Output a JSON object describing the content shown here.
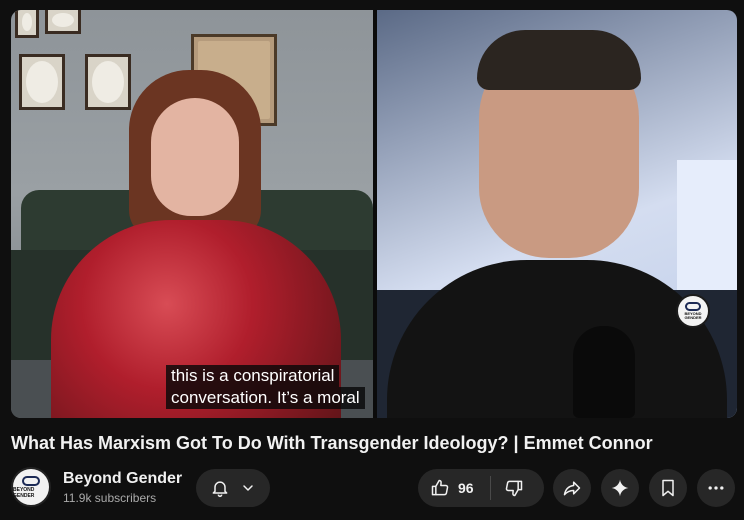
{
  "video": {
    "captions": [
      "this is a conspiratorial",
      "conversation. It’s a moral"
    ],
    "watermark_text": "BEYOND GENDER"
  },
  "title": "What Has Marxism Got To Do With Transgender Ideology? | Emmet Connor",
  "channel": {
    "name": "Beyond Gender",
    "subscribers": "11.9k subscribers",
    "avatar_text": "BEYOND GENDER"
  },
  "actions": {
    "like_count": "96"
  },
  "icons": {
    "notification": "bell-icon",
    "dropdown": "chevron-down-icon",
    "like": "thumbs-up-icon",
    "dislike": "thumbs-down-icon",
    "share": "share-icon",
    "ask": "sparkle-icon",
    "save": "bookmark-icon",
    "more": "more-horizontal-icon"
  },
  "colors": {
    "background": "#0f0f0f",
    "button_bg": "#272727",
    "text_primary": "#f1f1f1",
    "text_secondary": "#aaaaaa"
  }
}
